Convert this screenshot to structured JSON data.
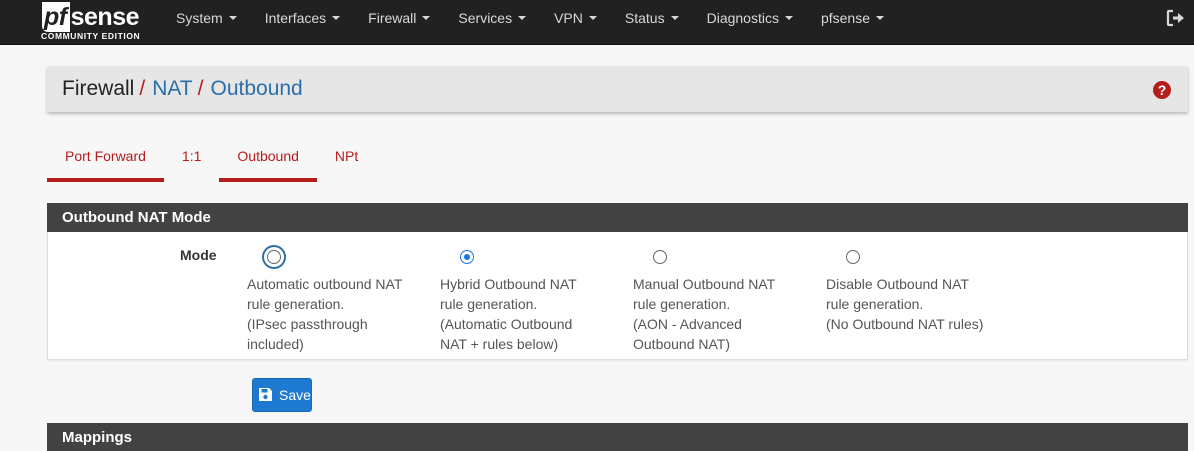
{
  "brand": {
    "logo_main": "sense",
    "logo_pf": "pf",
    "logo_sub": "COMMUNITY EDITION"
  },
  "nav": {
    "items": [
      "System",
      "Interfaces",
      "Firewall",
      "Services",
      "VPN",
      "Status",
      "Diagnostics",
      "pfsense"
    ],
    "logout_icon": "sign-out-icon"
  },
  "breadcrumb": {
    "first": "Firewall",
    "second": "NAT",
    "third": "Outbound",
    "separator": "/",
    "help_icon": "question-circle-icon",
    "help_glyph": "?"
  },
  "tabs": [
    {
      "label": "Port Forward",
      "active": true
    },
    {
      "label": "1:1",
      "active": false
    },
    {
      "label": "Outbound",
      "active": true
    },
    {
      "label": "NPt",
      "active": false
    }
  ],
  "mode_panel": {
    "title": "Outbound NAT Mode",
    "field_label": "Mode",
    "options": [
      {
        "lines": [
          "Automatic outbound NAT",
          "rule generation.",
          "(IPsec passthrough",
          "included)"
        ],
        "checked": false,
        "focused": true
      },
      {
        "lines": [
          "Hybrid Outbound NAT",
          "rule generation.",
          "(Automatic Outbound",
          "NAT + rules below)"
        ],
        "checked": true,
        "focused": false
      },
      {
        "lines": [
          "Manual Outbound NAT",
          "rule generation.",
          "(AON - Advanced",
          "Outbound NAT)"
        ],
        "checked": false,
        "focused": false
      },
      {
        "lines": [
          "Disable Outbound NAT",
          "rule generation.",
          "(No Outbound NAT rules)"
        ],
        "checked": false,
        "focused": false
      }
    ]
  },
  "save_button": {
    "label": "Save",
    "icon": "save-icon"
  },
  "mappings_panel": {
    "title": "Mappings"
  },
  "colors": {
    "navbar": "#212121",
    "accent_red": "#b71c1c",
    "link_blue": "#2b6fa8",
    "panel_head": "#424242",
    "save_blue": "#1e7ad1"
  }
}
